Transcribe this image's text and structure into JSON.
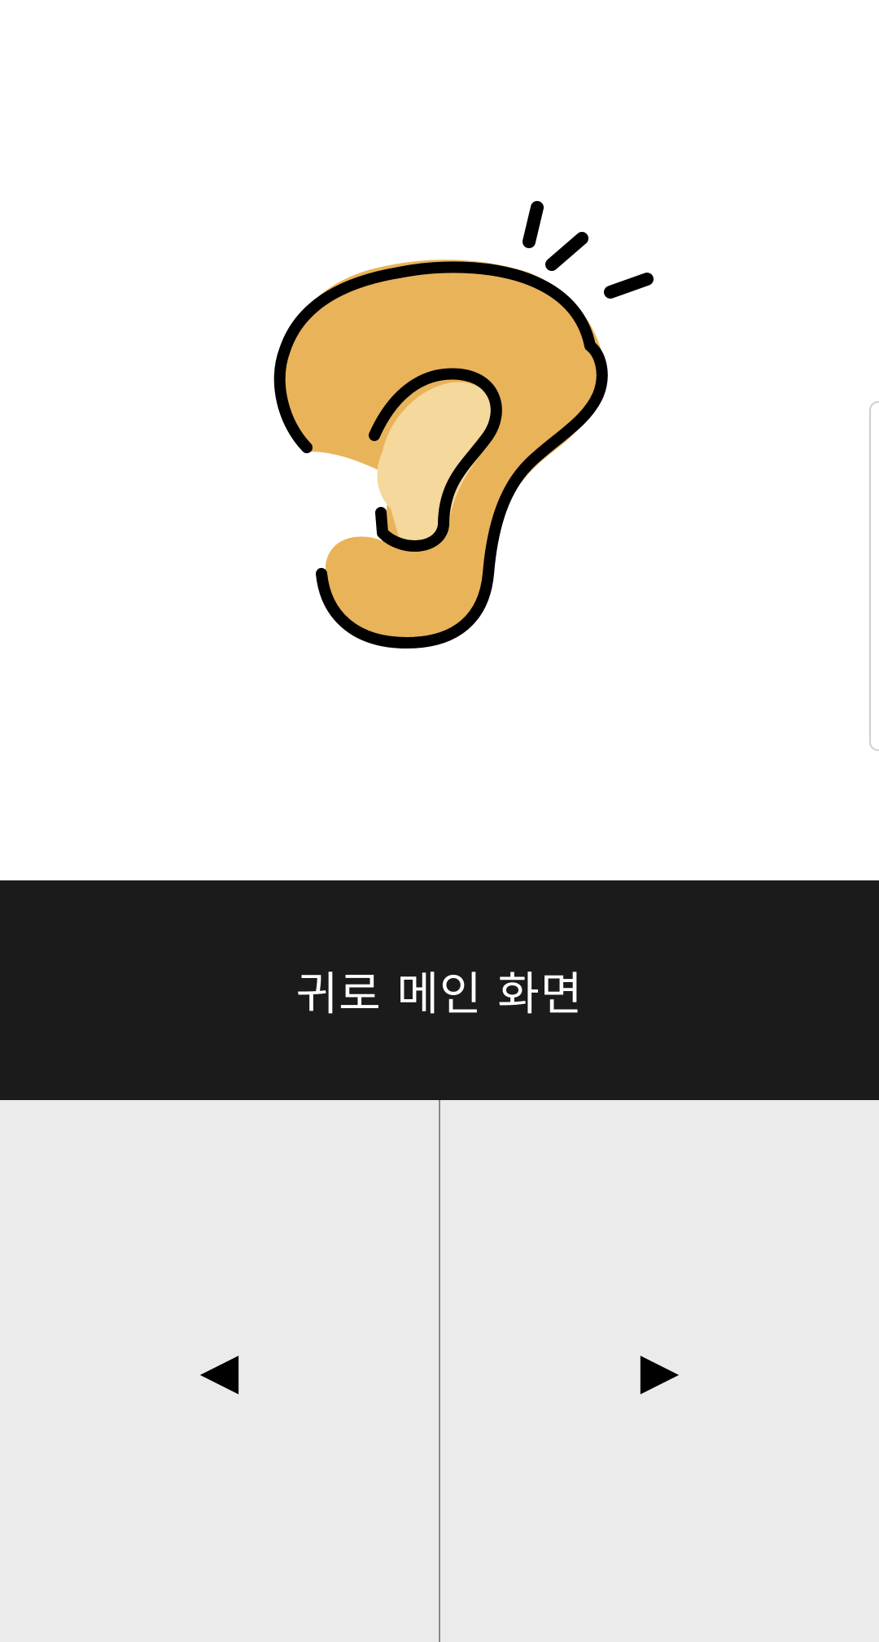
{
  "title_bar": {
    "title": "귀로 메인 화면"
  },
  "illustration": {
    "icon": "ear-icon",
    "colors": {
      "outer": "#E9B35A",
      "inner": "#F4D89C",
      "outline": "#000000"
    }
  },
  "navigation": {
    "prev_label": "◀",
    "next_label": "▶",
    "prev_icon": "triangle-left-icon",
    "next_icon": "triangle-right-icon"
  },
  "colors": {
    "title_bar_bg": "#1B1B1B",
    "nav_bg": "#EBEBEB",
    "divider": "#7D8B8B"
  }
}
